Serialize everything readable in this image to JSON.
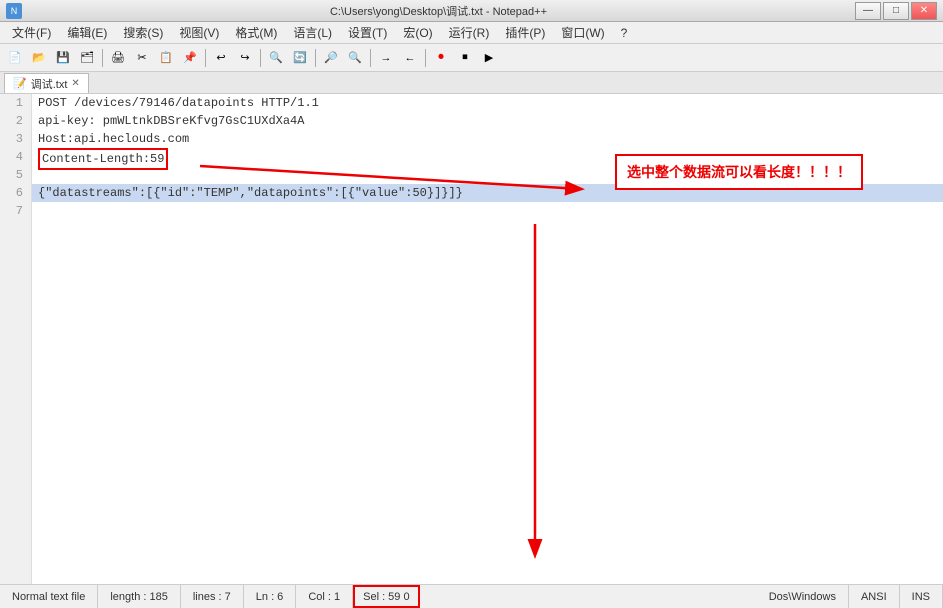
{
  "titlebar": {
    "title": "C:\\Users\\yong\\Desktop\\调试.txt - Notepad++",
    "minimize": "—",
    "maximize": "□",
    "close": "✕"
  },
  "menubar": {
    "items": [
      "文件(F)",
      "编辑(E)",
      "搜索(S)",
      "视图(V)",
      "格式(M)",
      "语言(L)",
      "设置(T)",
      "宏(O)",
      "运行(R)",
      "插件(P)",
      "窗口(W)",
      "?"
    ]
  },
  "tab": {
    "label": "调试.txt",
    "close": "✕"
  },
  "lines": [
    {
      "num": "1",
      "text": "POST /devices/79146/datapoints HTTP/1.1",
      "selected": false
    },
    {
      "num": "2",
      "text": "api-key: pmWLtnkDBSreKfvg7GsC1UXdXa4A",
      "selected": false
    },
    {
      "num": "3",
      "text": "Host:api.heclouds.com",
      "selected": false
    },
    {
      "num": "4",
      "text": "Content-Length:59",
      "selected": false,
      "highlight": true
    },
    {
      "num": "5",
      "text": "",
      "selected": false
    },
    {
      "num": "6",
      "text": "{\"datastreams\":[{\"id\":\"TEMP\",\"datapoints\":[{\"value\":50}]}]}",
      "selected": true
    },
    {
      "num": "7",
      "text": "",
      "selected": false
    }
  ],
  "annotation": {
    "text": "选中整个数据流可以看长度！！！！"
  },
  "statusbar": {
    "file_type": "Normal text file",
    "length": "length : 185",
    "lines": "lines : 7",
    "ln": "Ln : 6",
    "col": "Col : 1",
    "sel": "Sel : 59",
    "extra": "0",
    "encoding": "Dos\\Windows",
    "charset": "ANSI",
    "mode": "INS"
  }
}
